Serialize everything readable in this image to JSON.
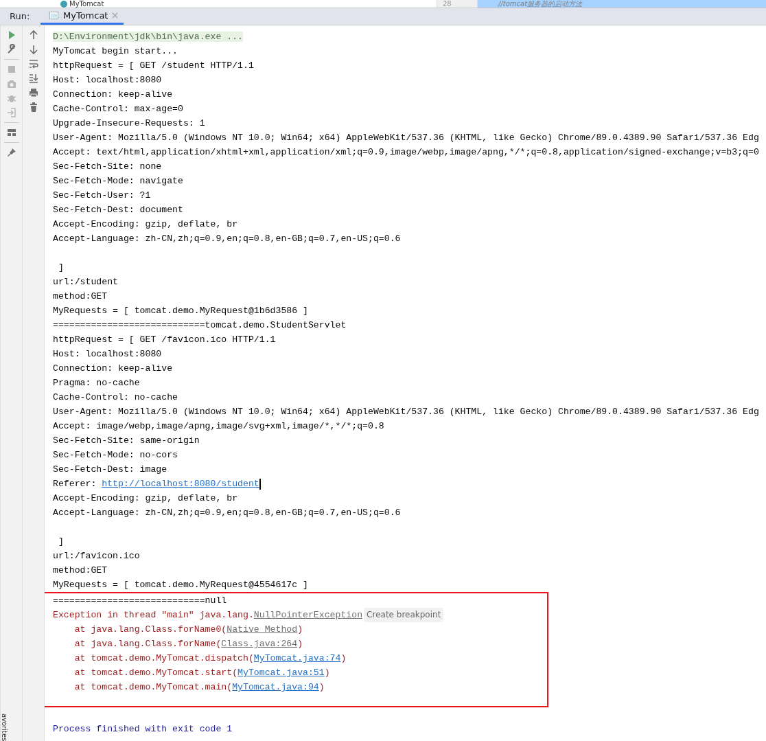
{
  "editor_strip": {
    "tree_item": "MyTomcat",
    "line_number": "28",
    "code_comment": "//tomcat服务器的启动方法"
  },
  "run_panel": {
    "label": "Run:",
    "tabs": [
      {
        "label": "MyTomcat",
        "selected": true
      }
    ]
  },
  "toolbar_left": [
    {
      "items": [
        {
          "disabled": false
        },
        {
          "disabled": false
        }
      ]
    },
    {
      "items": [
        {
          "disabled": true
        },
        {
          "disabled": true
        },
        {
          "disabled": true
        },
        {
          "disabled": true
        }
      ]
    },
    {
      "items": [
        {
          "disabled": false
        }
      ]
    },
    {
      "items": [
        {
          "disabled": false
        }
      ]
    }
  ],
  "side_stripe": "avorites",
  "console": {
    "lines": [
      {
        "kind": "command",
        "segments": [
          {
            "text": "D:\\Environment\\jdk\\bin\\java.exe ..."
          }
        ]
      },
      {
        "kind": "out",
        "segments": [
          {
            "text": "MyTomcat begin start..."
          }
        ]
      },
      {
        "kind": "out",
        "segments": [
          {
            "text": "httpRequest = [ GET /student HTTP/1.1"
          }
        ]
      },
      {
        "kind": "out",
        "segments": [
          {
            "text": "Host: localhost:8080"
          }
        ]
      },
      {
        "kind": "out",
        "segments": [
          {
            "text": "Connection: keep-alive"
          }
        ]
      },
      {
        "kind": "out",
        "segments": [
          {
            "text": "Cache-Control: max-age=0"
          }
        ]
      },
      {
        "kind": "out",
        "segments": [
          {
            "text": "Upgrade-Insecure-Requests: 1"
          }
        ]
      },
      {
        "kind": "out",
        "segments": [
          {
            "text": "User-Agent: Mozilla/5.0 (Windows NT 10.0; Win64; x64) AppleWebKit/537.36 (KHTML, like Gecko) Chrome/89.0.4389.90 Safari/537.36 Edg"
          }
        ]
      },
      {
        "kind": "out",
        "segments": [
          {
            "text": "Accept: text/html,application/xhtml+xml,application/xml;q=0.9,image/webp,image/apng,*/*;q=0.8,application/signed-exchange;v=b3;q=0"
          }
        ]
      },
      {
        "kind": "out",
        "segments": [
          {
            "text": "Sec-Fetch-Site: none"
          }
        ]
      },
      {
        "kind": "out",
        "segments": [
          {
            "text": "Sec-Fetch-Mode: navigate"
          }
        ]
      },
      {
        "kind": "out",
        "segments": [
          {
            "text": "Sec-Fetch-User: ?1"
          }
        ]
      },
      {
        "kind": "out",
        "segments": [
          {
            "text": "Sec-Fetch-Dest: document"
          }
        ]
      },
      {
        "kind": "out",
        "segments": [
          {
            "text": "Accept-Encoding: gzip, deflate, br"
          }
        ]
      },
      {
        "kind": "out",
        "segments": [
          {
            "text": "Accept-Language: zh-CN,zh;q=0.9,en;q=0.8,en-GB;q=0.7,en-US;q=0.6"
          }
        ]
      },
      {
        "kind": "blank"
      },
      {
        "kind": "out",
        "segments": [
          {
            "text": " ]"
          }
        ]
      },
      {
        "kind": "out",
        "segments": [
          {
            "text": "url:/student"
          }
        ]
      },
      {
        "kind": "out",
        "segments": [
          {
            "text": "method:GET"
          }
        ]
      },
      {
        "kind": "out",
        "segments": [
          {
            "text": "MyRequests = [ tomcat.demo.MyRequest@1b6d3586 ]"
          }
        ]
      },
      {
        "kind": "out",
        "segments": [
          {
            "text": "============================tomcat.demo.StudentServlet"
          }
        ]
      },
      {
        "kind": "out",
        "segments": [
          {
            "text": "httpRequest = [ GET /favicon.ico HTTP/1.1"
          }
        ]
      },
      {
        "kind": "out",
        "segments": [
          {
            "text": "Host: localhost:8080"
          }
        ]
      },
      {
        "kind": "out",
        "segments": [
          {
            "text": "Connection: keep-alive"
          }
        ]
      },
      {
        "kind": "out",
        "segments": [
          {
            "text": "Pragma: no-cache"
          }
        ]
      },
      {
        "kind": "out",
        "segments": [
          {
            "text": "Cache-Control: no-cache"
          }
        ]
      },
      {
        "kind": "out",
        "segments": [
          {
            "text": "User-Agent: Mozilla/5.0 (Windows NT 10.0; Win64; x64) AppleWebKit/537.36 (KHTML, like Gecko) Chrome/89.0.4389.90 Safari/537.36 Edg"
          }
        ]
      },
      {
        "kind": "out",
        "segments": [
          {
            "text": "Accept: image/webp,image/apng,image/svg+xml,image/*,*/*;q=0.8"
          }
        ]
      },
      {
        "kind": "out",
        "segments": [
          {
            "text": "Sec-Fetch-Site: same-origin"
          }
        ]
      },
      {
        "kind": "out",
        "segments": [
          {
            "text": "Sec-Fetch-Mode: no-cors"
          }
        ]
      },
      {
        "kind": "out",
        "segments": [
          {
            "text": "Sec-Fetch-Dest: image"
          }
        ]
      },
      {
        "kind": "out",
        "caret": true,
        "segments": [
          {
            "kind": "plain",
            "text": "Referer: "
          },
          {
            "kind": "url",
            "text": "http://localhost:8080/student"
          }
        ]
      },
      {
        "kind": "out",
        "segments": [
          {
            "text": "Accept-Encoding: gzip, deflate, br"
          }
        ]
      },
      {
        "kind": "out",
        "segments": [
          {
            "text": "Accept-Language: zh-CN,zh;q=0.9,en;q=0.8,en-GB;q=0.7,en-US;q=0.6"
          }
        ]
      },
      {
        "kind": "blank"
      },
      {
        "kind": "out",
        "segments": [
          {
            "text": " ]"
          }
        ]
      },
      {
        "kind": "out",
        "segments": [
          {
            "text": "url:/favicon.ico"
          }
        ]
      },
      {
        "kind": "out",
        "segments": [
          {
            "text": "method:GET"
          }
        ]
      },
      {
        "kind": "out",
        "segments": [
          {
            "text": "MyRequests = [ tomcat.demo.MyRequest@4554617c ]"
          }
        ]
      }
    ],
    "highlight_box": {
      "lines": [
        {
          "kind": "out",
          "segments": [
            {
              "text": "============================null"
            }
          ]
        },
        {
          "kind": "err",
          "segments": [
            {
              "kind": "plain",
              "text": "Exception in thread \"main\" java.lang."
            },
            {
              "kind": "native",
              "text": "NullPointerException"
            },
            {
              "kind": "chip",
              "text": "Create breakpoint"
            }
          ]
        },
        {
          "kind": "err",
          "segments": [
            {
              "kind": "plain",
              "text": "    at java.lang.Class.forName0("
            },
            {
              "kind": "native",
              "text": "Native Method"
            },
            {
              "kind": "plain",
              "text": ")"
            }
          ]
        },
        {
          "kind": "err",
          "segments": [
            {
              "kind": "plain",
              "text": "    at java.lang.Class.forName("
            },
            {
              "kind": "native",
              "text": "Class.java:264"
            },
            {
              "kind": "plain",
              "text": ")"
            }
          ]
        },
        {
          "kind": "err",
          "segments": [
            {
              "kind": "plain",
              "text": "    at tomcat.demo.MyTomcat.dispatch("
            },
            {
              "kind": "file",
              "text": "MyTomcat.java:74"
            },
            {
              "kind": "plain",
              "text": ")"
            }
          ]
        },
        {
          "kind": "err",
          "segments": [
            {
              "kind": "plain",
              "text": "    at tomcat.demo.MyTomcat.start("
            },
            {
              "kind": "file",
              "text": "MyTomcat.java:51"
            },
            {
              "kind": "plain",
              "text": ")"
            }
          ]
        },
        {
          "kind": "err",
          "segments": [
            {
              "kind": "plain",
              "text": "    at tomcat.demo.MyTomcat.main("
            },
            {
              "kind": "file",
              "text": "MyTomcat.java:94"
            },
            {
              "kind": "plain",
              "text": ")"
            }
          ]
        }
      ]
    },
    "after_lines": [
      {
        "kind": "blank"
      },
      {
        "kind": "system",
        "segments": [
          {
            "text": "Process finished with exit code 1"
          }
        ]
      }
    ]
  }
}
